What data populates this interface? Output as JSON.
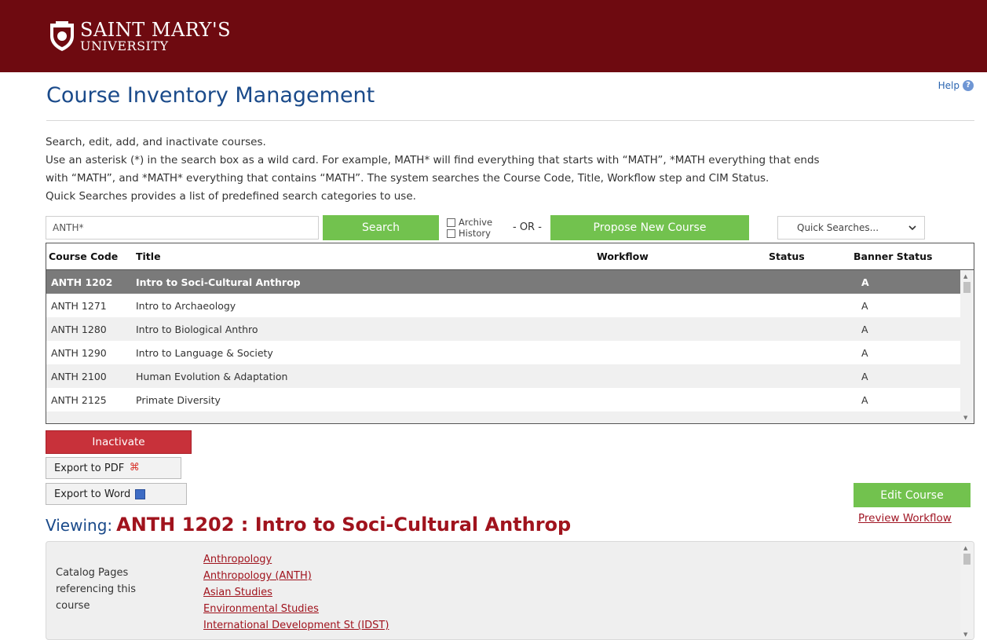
{
  "header": {
    "logo_line1": "SAINT MARY'S",
    "logo_line2": "UNIVERSITY",
    "brand_color": "#6e0a10"
  },
  "help": {
    "label": "Help"
  },
  "page": {
    "title": "Course Inventory Management",
    "intro": [
      "Search, edit, add, and inactivate courses.",
      "Use an asterisk (*) in the search box as a wild card. For example, MATH* will find everything that starts with “MATH”, *MATH everything that ends",
      "with “MATH”, and *MATH* everything that contains “MATH”. The system searches the Course Code, Title, Workflow step and CIM Status.",
      "Quick Searches provides a list of predefined search categories to use."
    ]
  },
  "search": {
    "value": "ANTH*",
    "button": "Search",
    "archive_label": "Archive",
    "history_label": "History",
    "or_text": "- OR -",
    "propose_button": "Propose New Course",
    "quick_searches": "Quick Searches...",
    "accent_color": "#72c24e"
  },
  "table": {
    "columns": [
      "Course Code",
      "Title",
      "Workflow",
      "Status",
      "Banner Status"
    ],
    "rows": [
      {
        "code": "ANTH 1202",
        "title": "Intro to Soci-Cultural Anthrop",
        "workflow": "",
        "status": "",
        "banner": "A"
      },
      {
        "code": "ANTH 1271",
        "title": "Intro to Archaeology",
        "workflow": "",
        "status": "",
        "banner": "A"
      },
      {
        "code": "ANTH 1280",
        "title": "Intro to Biological Anthro",
        "workflow": "",
        "status": "",
        "banner": "A"
      },
      {
        "code": "ANTH 1290",
        "title": "Intro to Language & Society",
        "workflow": "",
        "status": "",
        "banner": "A"
      },
      {
        "code": "ANTH 2100",
        "title": "Human Evolution & Adaptation",
        "workflow": "",
        "status": "",
        "banner": "A"
      },
      {
        "code": "ANTH 2125",
        "title": "Primate Diversity",
        "workflow": "",
        "status": "",
        "banner": "A"
      }
    ],
    "selected_index": 0
  },
  "actions": {
    "inactivate": "Inactivate",
    "export_pdf": "Export to PDF",
    "export_word": "Export to Word",
    "edit_course": "Edit Course",
    "preview_workflow": "Preview Workflow"
  },
  "viewing": {
    "label": "Viewing:",
    "value": "ANTH 1202 : Intro to Soci-Cultural Anthrop"
  },
  "catalog": {
    "label": "Catalog Pages referencing this course",
    "links": [
      "Anthropology",
      "Anthropology (ANTH)",
      "Asian Studies",
      "Environmental Studies",
      "International Development St (IDST)"
    ]
  }
}
